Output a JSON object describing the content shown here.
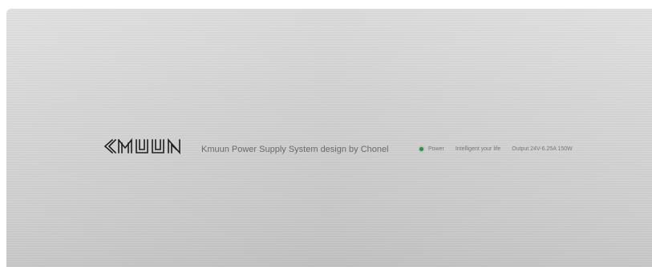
{
  "device": {
    "logo_text": "KMUUN",
    "tagline": "Kmuun Power Supply System design by Chonel",
    "indicator_label": "Power",
    "slogan": "Intelligent your life",
    "output_spec": "Output 24V-6.25A 150W",
    "led_color": "#2f8f47",
    "panel_finish": "brushed-aluminum"
  }
}
